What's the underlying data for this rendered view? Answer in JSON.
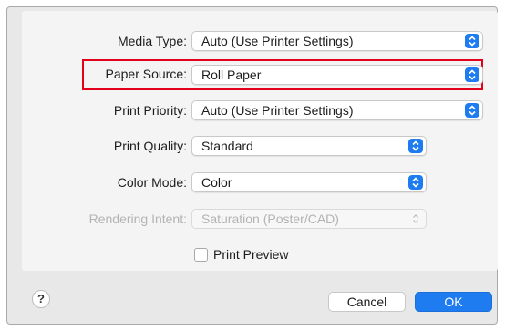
{
  "form": {
    "rows": [
      {
        "label": "Media Type:",
        "value": "Auto (Use Printer Settings)",
        "enabled": true
      },
      {
        "label": "Paper Source:",
        "value": "Roll Paper",
        "enabled": true
      },
      {
        "label": "Print Priority:",
        "value": "Auto (Use Printer Settings)",
        "enabled": true
      },
      {
        "label": "Print Quality:",
        "value": "Standard",
        "enabled": true
      },
      {
        "label": "Color Mode:",
        "value": "Color",
        "enabled": true
      },
      {
        "label": "Rendering Intent:",
        "value": "Saturation (Poster/CAD)",
        "enabled": false
      }
    ],
    "preview_checkbox": {
      "label": "Print Preview",
      "checked": false
    }
  },
  "buttons": {
    "help": "?",
    "cancel": "Cancel",
    "ok": "OK"
  },
  "colors": {
    "accent": "#1f7cf0",
    "highlight": "#e2001a"
  }
}
